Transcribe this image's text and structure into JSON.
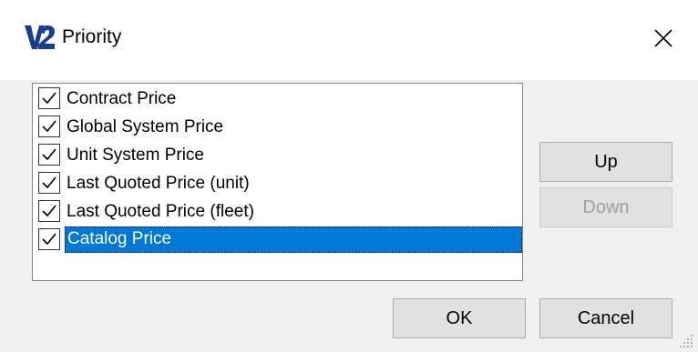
{
  "window": {
    "title": "Priority",
    "logo_icon": "v2-logo-icon",
    "close_icon": "close-icon"
  },
  "list": {
    "items": [
      {
        "label": "Contract Price",
        "checked": true,
        "selected": false
      },
      {
        "label": "Global System Price",
        "checked": true,
        "selected": false
      },
      {
        "label": "Unit System Price",
        "checked": true,
        "selected": false
      },
      {
        "label": "Last Quoted Price (unit)",
        "checked": true,
        "selected": false
      },
      {
        "label": "Last Quoted Price (fleet)",
        "checked": true,
        "selected": false
      },
      {
        "label": "Catalog Price",
        "checked": true,
        "selected": true
      }
    ]
  },
  "buttons": {
    "up": "Up",
    "down": "Down",
    "ok": "OK",
    "cancel": "Cancel"
  },
  "colors": {
    "selection": "#0078d7",
    "dialog_bg": "#f0f0f0",
    "button_bg": "#e1e1e1"
  }
}
